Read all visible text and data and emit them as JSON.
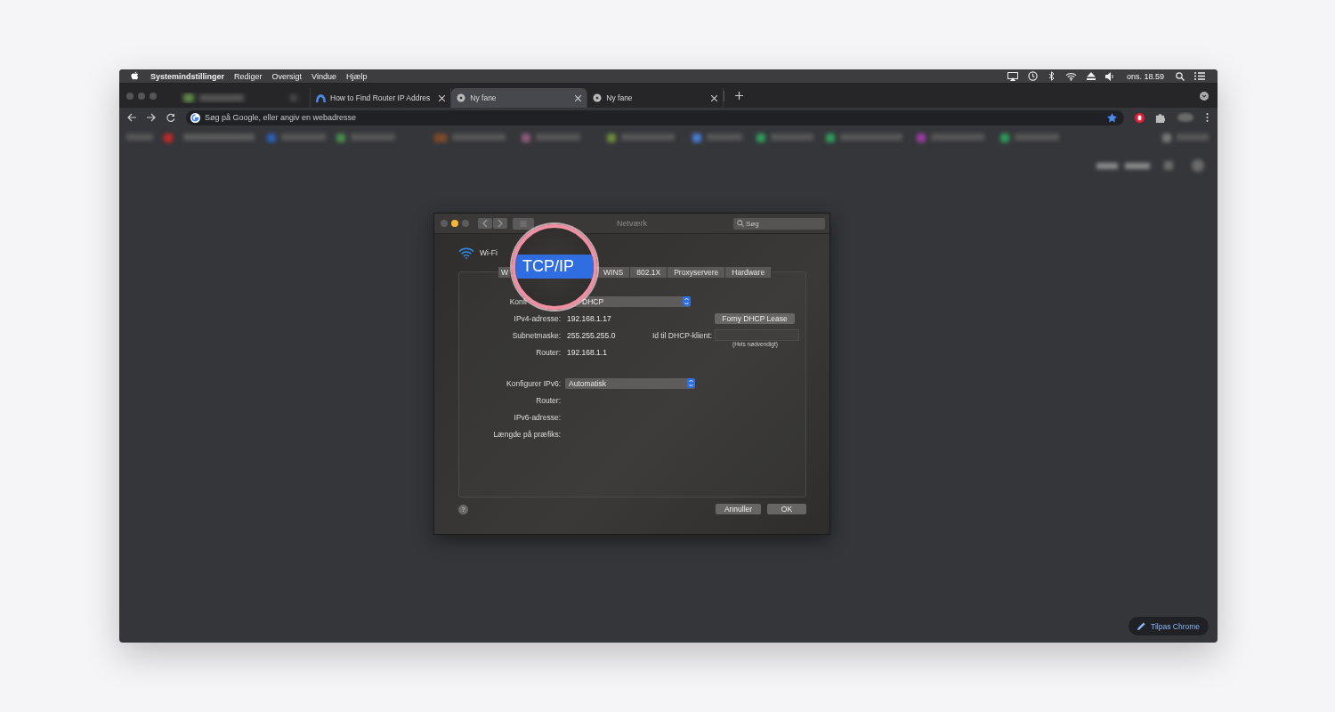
{
  "menu_bar": {
    "app_name": "Systemindstillinger",
    "items": [
      "Rediger",
      "Oversigt",
      "Vindue",
      "Hjælp"
    ],
    "clock": "ons. 18.59"
  },
  "browser": {
    "tabs": [
      {
        "kind": "blurred",
        "selected": false
      },
      {
        "kind": "page",
        "title": "How to Find Router IP Addres",
        "selected": false
      },
      {
        "kind": "newtab",
        "title": "Ny fane",
        "selected": true
      },
      {
        "kind": "newtab",
        "title": "Ny fane",
        "selected": false
      }
    ],
    "address_bar": {
      "placeholder": "Søg på Google, eller angiv en webadresse"
    },
    "customize_button": "Tilpas Chrome"
  },
  "dialog": {
    "title": "Netværk",
    "search": {
      "placeholder": "Søg"
    },
    "interface": "Wi-Fi",
    "tabs": [
      {
        "label": "W",
        "selected": false
      },
      {
        "label": "TCP/IP",
        "selected": true
      },
      {
        "label": "WINS",
        "selected": false
      },
      {
        "label": "802.1X",
        "selected": false
      },
      {
        "label": "Proxyservere",
        "selected": false
      },
      {
        "label": "Hardware",
        "selected": false
      }
    ],
    "ipv4": {
      "configure_label": "Konfi",
      "configure_value": "DHCP",
      "rows": [
        {
          "label": "IPv4-adresse:",
          "value": "192.168.1.17"
        },
        {
          "label": "Subnetmaske:",
          "value": "255.255.255.0"
        },
        {
          "label": "Router:",
          "value": "192.168.1.1"
        }
      ],
      "renew_button": "Forny DHCP Lease",
      "client_id_label": "Id til DHCP-klient:",
      "client_id_hint": "(Hvis nødvendigt)"
    },
    "ipv6": {
      "configure_label": "Konfigurer IPv6:",
      "configure_value": "Automatisk",
      "rows": [
        {
          "label": "Router:"
        },
        {
          "label": "IPv6-adresse:"
        },
        {
          "label": "Længde på præfiks:"
        }
      ]
    },
    "help": "?",
    "buttons": [
      "Annuller",
      "OK"
    ]
  }
}
